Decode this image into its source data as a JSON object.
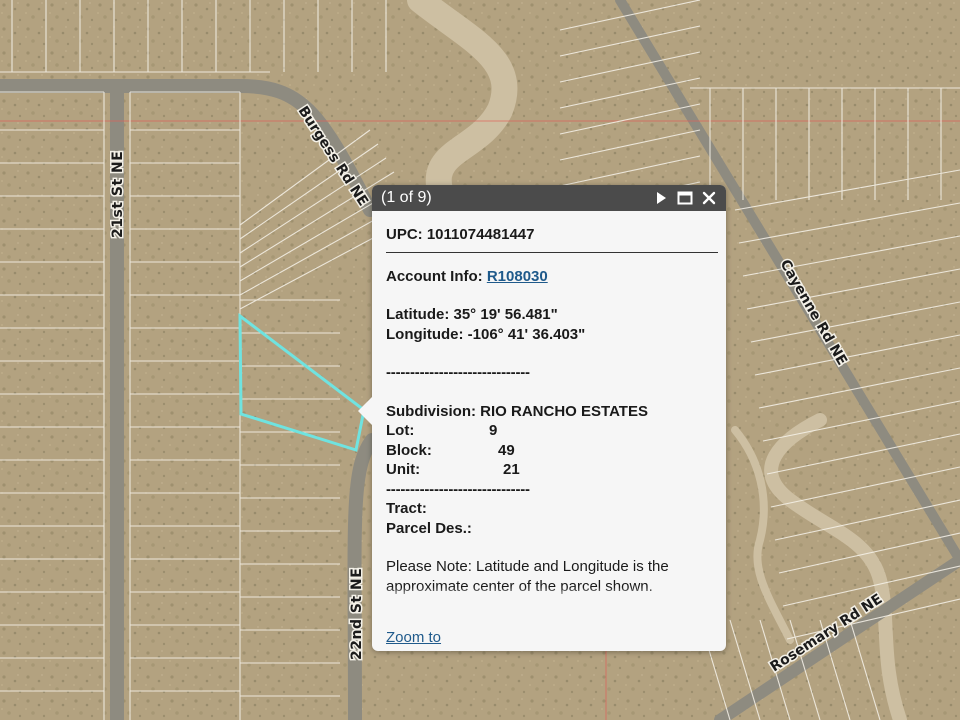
{
  "map": {
    "streets": {
      "st21": "21st St NE",
      "burgess": "Burgess Rd NE",
      "cayenne": "Cayenne Rd NE",
      "st22": "22nd St NE",
      "rosemary": "Rosemary Rd NE"
    },
    "colors": {
      "ground": "#b3a280",
      "parcel_line": "#ffffff",
      "selection": "#6fe3e0",
      "section_line": "#e0605a"
    }
  },
  "popup": {
    "counter": "(1 of 9)",
    "icons": {
      "next": "next-arrow-icon",
      "maximize": "maximize-icon",
      "close": "close-icon"
    },
    "upc": {
      "label": "UPC:",
      "value": "1011074481447"
    },
    "account": {
      "label": "Account Info:",
      "value": "R108030"
    },
    "latitude": {
      "label": "Latitude:",
      "value": "35° 19' 56.481\""
    },
    "longitude": {
      "label": "Longitude:",
      "value": "-106° 41' 36.403\""
    },
    "dashes": "------------------------------",
    "subdivision": {
      "label": "Subdivision:",
      "value": "RIO RANCHO ESTATES"
    },
    "lot": {
      "label": "Lot:",
      "value": "9"
    },
    "block": {
      "label": "Block:",
      "value": "49"
    },
    "unit": {
      "label": "Unit:",
      "value": "21"
    },
    "tract": {
      "label": "Tract:",
      "value": ""
    },
    "parcel_des": {
      "label": "Parcel Des.:",
      "value": ""
    },
    "note": "Please Note: Latitude and Longitude is the approximate center of the parcel shown.",
    "zoom_link": "Zoom to"
  }
}
